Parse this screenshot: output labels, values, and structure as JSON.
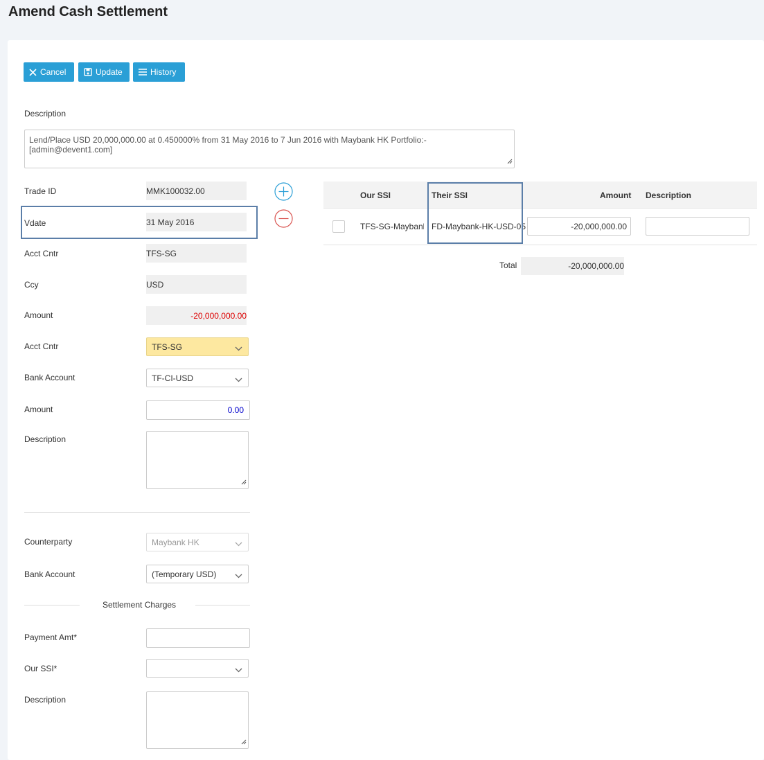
{
  "page": {
    "title": "Amend Cash Settlement"
  },
  "toolbar": {
    "cancel_label": "Cancel",
    "update_label": "Update",
    "history_label": "History"
  },
  "description": {
    "label": "Description",
    "value": "Lend/Place USD 20,000,000.00 at 0.450000% from 31 May 2016 to 7 Jun 2016 with Maybank HK  Portfolio:- [admin@devent1.com]"
  },
  "trade": {
    "trade_id_label": "Trade ID",
    "trade_id": "MMK100032.00",
    "vdate_label": "Vdate",
    "vdate": "31 May 2016",
    "acct_cntr_label": "Acct Cntr",
    "acct_cntr": "TFS-SG",
    "ccy_label": "Ccy",
    "ccy": "USD",
    "amount_label": "Amount",
    "amount": "-20,000,000.00"
  },
  "our_side": {
    "acct_cntr_label": "Acct Cntr",
    "acct_cntr": "TFS-SG",
    "bank_account_label": "Bank Account",
    "bank_account": "TF-CI-USD",
    "amount_label": "Amount",
    "amount": "0.00",
    "description_label": "Description",
    "description": ""
  },
  "counterparty": {
    "counterparty_label": "Counterparty",
    "counterparty": "Maybank HK",
    "bank_account_label": "Bank Account",
    "bank_account": "(Temporary USD)"
  },
  "charges": {
    "section_label": "Settlement Charges",
    "payment_amt_label": "Payment Amt*",
    "payment_amt": "",
    "our_ssi_label": "Our SSI*",
    "our_ssi": "",
    "description_label": "Description",
    "description": ""
  },
  "table": {
    "headers": {
      "our_ssi": "Our SSI",
      "their_ssi": "Their SSI",
      "amount": "Amount",
      "description": "Description"
    },
    "rows": [
      {
        "our_ssi": "TFS-SG-Maybank-",
        "their_ssi": "FD-Maybank-HK-USD-05",
        "amount": "-20,000,000.00",
        "description": ""
      }
    ],
    "total_label": "Total",
    "total": "-20,000,000.00"
  },
  "icons": {
    "add": "plus-circle-icon",
    "remove": "minus-circle-icon"
  },
  "colors": {
    "accent": "#2a9fd6",
    "negative": "#dd0000",
    "highlight": "#fde8a0",
    "annotation_box": "#5b7ea8"
  }
}
